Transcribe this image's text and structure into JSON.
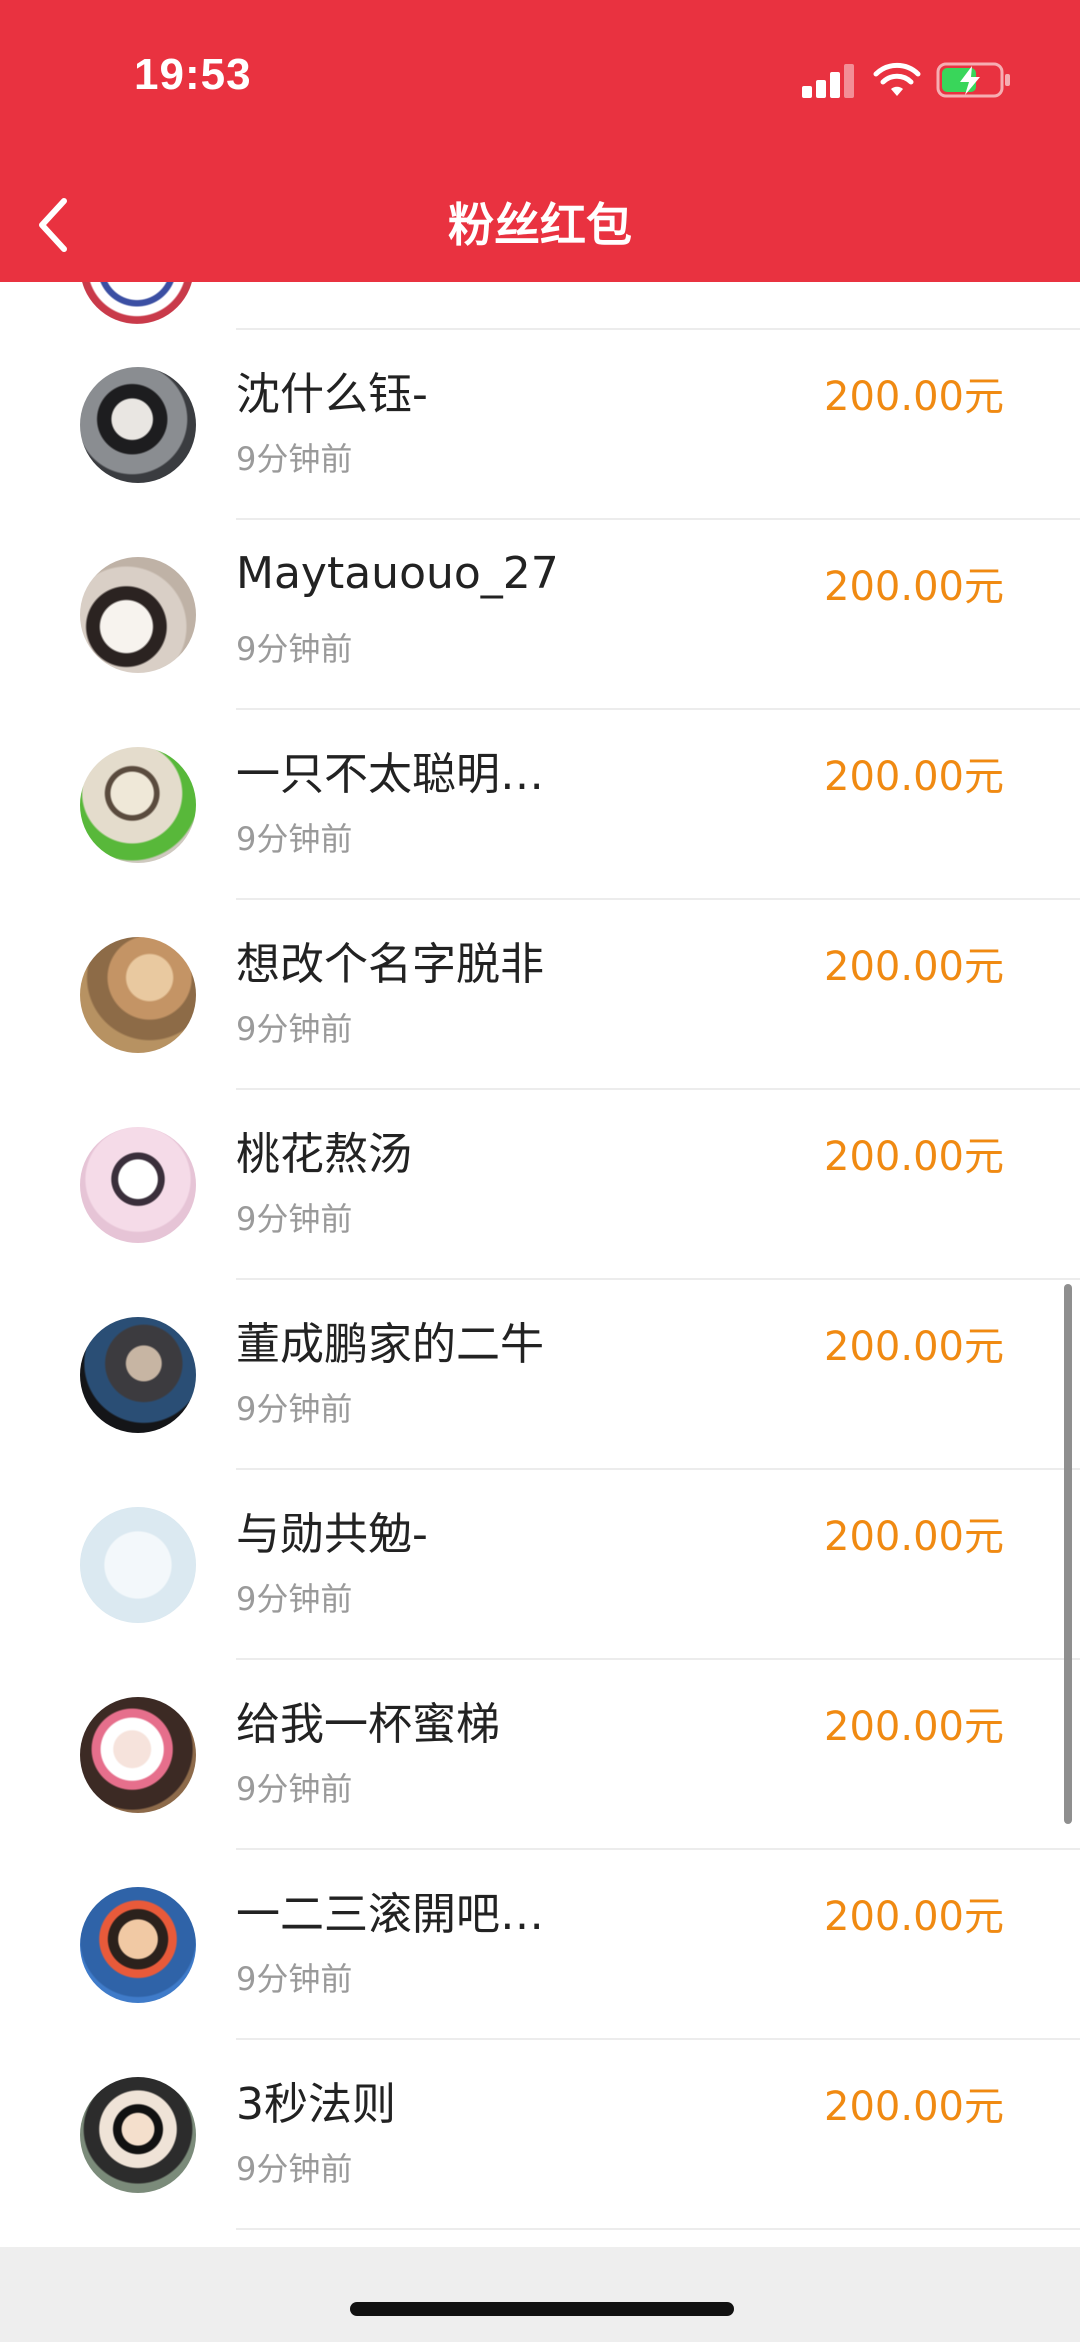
{
  "status_bar": {
    "time": "19:53"
  },
  "header": {
    "title": "粉丝红包"
  },
  "colors": {
    "header_bg": "#e93240",
    "amount": "#f08a12"
  },
  "list": {
    "items": [
      {
        "name": "沈什么钰-",
        "time": "9分钟前",
        "amount": "200.00元",
        "avatar": "girl-car-photo"
      },
      {
        "name": "Maytauouo_27",
        "time": "9分钟前",
        "amount": "200.00元",
        "avatar": "girl-puppy-photo"
      },
      {
        "name": "一只不太聪明…",
        "time": "9分钟前",
        "amount": "200.00元",
        "avatar": "plush-toy"
      },
      {
        "name": "想改个名字脱非",
        "time": "9分钟前",
        "amount": "200.00元",
        "avatar": "cat-card"
      },
      {
        "name": "桃花熬汤",
        "time": "9分钟前",
        "amount": "200.00元",
        "avatar": "cartoon-kuromi"
      },
      {
        "name": "董成鹏家的二牛",
        "time": "9分钟前",
        "amount": "200.00元",
        "avatar": "man-dark-photo"
      },
      {
        "name": "与勋共勉-",
        "time": "9分钟前",
        "amount": "200.00元",
        "avatar": "handwriting-light-blue"
      },
      {
        "name": "给我一杯蜜梯",
        "time": "9分钟前",
        "amount": "200.00元",
        "avatar": "girl-hellokitty"
      },
      {
        "name": "一二三滚開吧…",
        "time": "9分钟前",
        "amount": "200.00元",
        "avatar": "boy-blue-bg"
      },
      {
        "name": "3秒法则",
        "time": "9分钟前",
        "amount": "200.00元",
        "avatar": "glasses-girl"
      }
    ]
  }
}
